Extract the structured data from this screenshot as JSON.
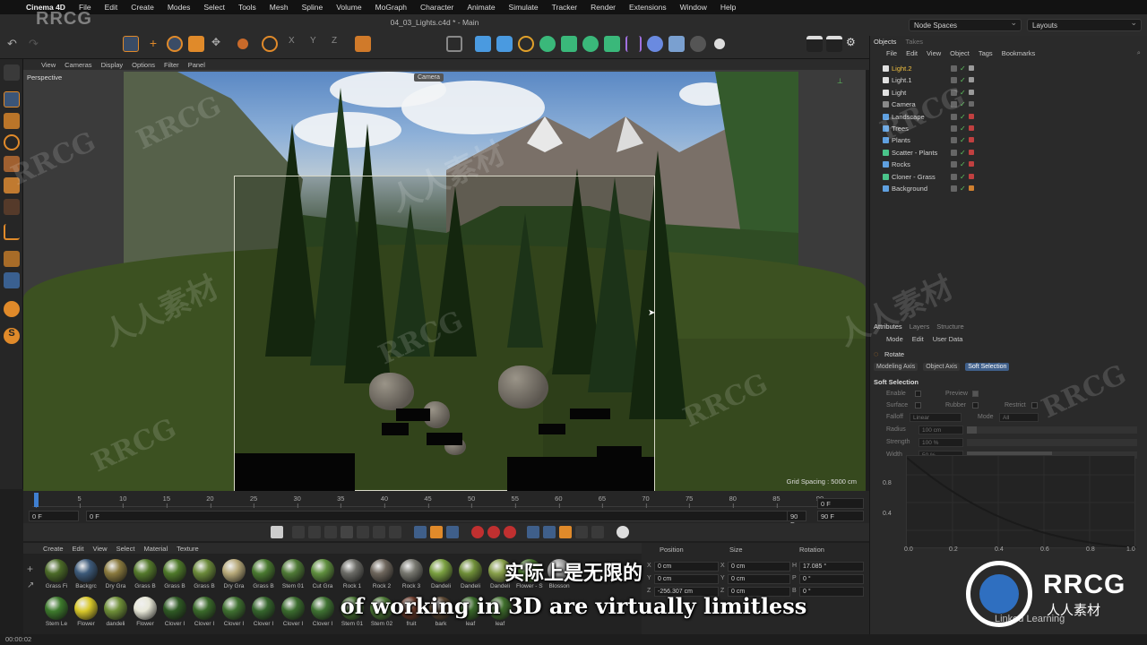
{
  "menubar": {
    "app": "Cinema 4D",
    "items": [
      "File",
      "Edit",
      "Create",
      "Modes",
      "Select",
      "Tools",
      "Mesh",
      "Spline",
      "Volume",
      "MoGraph",
      "Character",
      "Animate",
      "Simulate",
      "Tracker",
      "Render",
      "Extensions",
      "Window",
      "Help"
    ]
  },
  "window_title": "04_03_Lights.c4d * - Main",
  "top_right": {
    "node_spaces": "Node Spaces",
    "layouts": "Layouts"
  },
  "viewport": {
    "menu": [
      "View",
      "Cameras",
      "Display",
      "Options",
      "Filter",
      "Panel"
    ],
    "label": "Perspective",
    "camera_tag": "Camera",
    "grid_spacing": "Grid Spacing : 5000 cm"
  },
  "timeline": {
    "ticks": [
      "0",
      "5",
      "10",
      "15",
      "20",
      "25",
      "30",
      "35",
      "40",
      "45",
      "50",
      "55",
      "60",
      "65",
      "70",
      "75",
      "80",
      "85",
      "90"
    ],
    "current_frame": "0 F",
    "start_field": "0 F",
    "min_field": "0 F",
    "end_field": "90 F",
    "max_field": "90 F",
    "right_field": "0 F"
  },
  "materials": {
    "menu": [
      "Create",
      "Edit",
      "View",
      "Select",
      "Material",
      "Texture"
    ],
    "row1": [
      {
        "name": "Grass Fi",
        "color": "#4c6b28"
      },
      {
        "name": "Backgrc",
        "color": "#3d5a7a"
      },
      {
        "name": "Dry Gra",
        "color": "#8a7a3e"
      },
      {
        "name": "Grass B",
        "color": "#557a2c"
      },
      {
        "name": "Grass B",
        "color": "#4f7a2a"
      },
      {
        "name": "Grass B",
        "color": "#6b8a3a"
      },
      {
        "name": "Dry Gra",
        "color": "#b8aa7a"
      },
      {
        "name": "Grass B",
        "color": "#4a7a30"
      },
      {
        "name": "Stem 01",
        "color": "#4f7a36"
      },
      {
        "name": "Cut Gra",
        "color": "#5f8f3e"
      },
      {
        "name": "Rock 1",
        "color": "#6b6b66"
      },
      {
        "name": "Rock 2",
        "color": "#6e665c"
      },
      {
        "name": "Rock 3",
        "color": "#77776f"
      },
      {
        "name": "Dandeli",
        "color": "#7aa040"
      },
      {
        "name": "Dandeli",
        "color": "#6f8f38"
      },
      {
        "name": "Dandeli",
        "color": "#88a04a"
      },
      {
        "name": "Flower - Stem",
        "color": "#4c7a30"
      },
      {
        "name": "Blosson",
        "color": "#a0a0a0"
      }
    ],
    "row2": [
      {
        "name": "Stem Le",
        "color": "#3d7a2c"
      },
      {
        "name": "Flower",
        "color": "#d8c82a"
      },
      {
        "name": "dandeli",
        "color": "#6f8f38"
      },
      {
        "name": "Flower",
        "color": "#e8e8d8"
      },
      {
        "name": "Clover I",
        "color": "#2f5a24"
      },
      {
        "name": "Clover I",
        "color": "#3a6a2a"
      },
      {
        "name": "Clover I",
        "color": "#3f7030"
      },
      {
        "name": "Clover I",
        "color": "#35652c"
      },
      {
        "name": "Clover I",
        "color": "#3b6c2e"
      },
      {
        "name": "Clover I",
        "color": "#3f7232"
      },
      {
        "name": "Stem 01",
        "color": "#4a7634"
      },
      {
        "name": "Stem 02",
        "color": "#4d7a36"
      },
      {
        "name": "fruit",
        "color": "#6b3a2a"
      },
      {
        "name": "bark",
        "color": "#5a4632"
      },
      {
        "name": "leaf",
        "color": "#3a6a2a"
      },
      {
        "name": "leaf",
        "color": "#3f6f2c"
      }
    ]
  },
  "coordinates": {
    "headers": [
      "Position",
      "Size",
      "Rotation"
    ],
    "x_pos": "0 cm",
    "x_size": "0 cm",
    "h_rot": "17.085 °",
    "y_pos": "0 cm",
    "y_size": "0 cm",
    "p_rot": "0 °",
    "z_pos": "-256.307 cm",
    "z_size": "0 cm",
    "b_rot": "0 °"
  },
  "status": {
    "time": "00:00:02"
  },
  "objects": {
    "tabs": [
      "Objects",
      "Takes"
    ],
    "menu": [
      "File",
      "Edit",
      "View",
      "Object",
      "Tags",
      "Bookmarks"
    ],
    "items": [
      {
        "name": "Light.2",
        "highlight": true,
        "icon": "#e0e0e0",
        "tag": "#9a9a9a"
      },
      {
        "name": "Light.1",
        "highlight": false,
        "icon": "#e0e0e0",
        "tag": "#9a9a9a"
      },
      {
        "name": "Light",
        "highlight": false,
        "icon": "#e0e0e0",
        "tag": "#9a9a9a"
      },
      {
        "name": "Camera",
        "highlight": false,
        "icon": "#8a8a8a",
        "tag": "#6a6a6a"
      },
      {
        "name": "Landscape",
        "highlight": false,
        "icon": "#5fa0e0",
        "tag": "#c04040"
      },
      {
        "name": "Trees",
        "highlight": false,
        "icon": "#5fa0e0",
        "tag": "#c04040"
      },
      {
        "name": "Plants",
        "highlight": false,
        "icon": "#5fa0e0",
        "tag": "#c04040"
      },
      {
        "name": "Scatter - Plants",
        "highlight": false,
        "icon": "#4ac48a",
        "tag": "#c04040"
      },
      {
        "name": "Rocks",
        "highlight": false,
        "icon": "#5fa0e0",
        "tag": "#c04040"
      },
      {
        "name": "Cloner - Grass",
        "highlight": false,
        "icon": "#4ac48a",
        "tag": "#c04040"
      },
      {
        "name": "Background",
        "highlight": false,
        "icon": "#5fa0e0",
        "tag": "#d08030"
      }
    ]
  },
  "attributes": {
    "tabs": [
      "Attributes",
      "Layers",
      "Structure"
    ],
    "menu": [
      "Mode",
      "Edit",
      "User Data"
    ],
    "title": "Rotate",
    "subtabs": [
      "Modeling Axis",
      "Object Axis",
      "Soft Selection"
    ],
    "active_subtab": "Soft Selection",
    "section": "Soft Selection",
    "enable": "Enable",
    "preview": "Preview",
    "surface": "Surface",
    "rubber": "Rubber",
    "restrict": "Restrict",
    "falloff": "Falloff",
    "falloff_val": "Linear",
    "mode": "Mode",
    "mode_val": "All",
    "radius": "Radius",
    "radius_val": "100 cm",
    "strength": "Strength",
    "strength_val": "100 %",
    "width": "Width",
    "width_val": "50 %",
    "graph_y": [
      "0.8",
      "0.4"
    ],
    "graph_x": [
      "0.0",
      "0.2",
      "0.4",
      "0.6",
      "0.8",
      "1.0"
    ]
  },
  "subtitles": {
    "cn": "实际上是无限的",
    "en": "of working in 3D are virtually limitless"
  },
  "branding": {
    "rrcg_top": "RRCG",
    "logo_text": "RRCG",
    "logo_sub": "人人素材",
    "linkedin": "Linked Learning",
    "watermark": "RRCG",
    "watermark_cn": "人人素材"
  }
}
